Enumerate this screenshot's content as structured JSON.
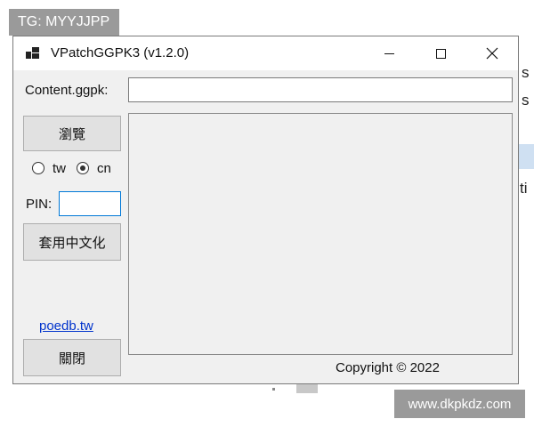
{
  "overlay": {
    "tag_text": "TG: MYYJJPP",
    "watermark_text": "www.dkpkdz.com"
  },
  "background": {
    "letters": [
      "s",
      "s",
      "ti"
    ]
  },
  "window": {
    "title": "VPatchGGPK3 (v1.2.0)",
    "controls": {
      "minimize": "minimize",
      "maximize": "maximize",
      "close": "close"
    }
  },
  "content": {
    "ggpk_label": "Content.ggpk:",
    "ggpk_value": "",
    "browse_label": "瀏覽",
    "radio_tw_label": "tw",
    "radio_cn_label": "cn",
    "selected_region": "cn",
    "pin_label": "PIN:",
    "pin_value": "",
    "apply_label": "套用中文化",
    "link_text": "poedb.tw",
    "close_label": "關閉",
    "log_text": "",
    "copyright_text": "Copyright © 2022"
  }
}
